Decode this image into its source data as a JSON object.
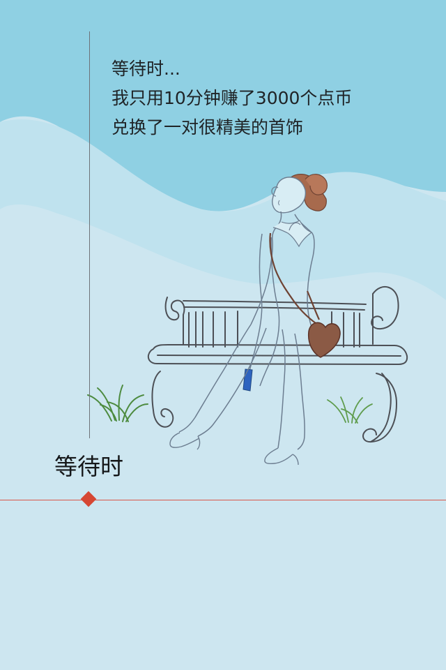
{
  "story": {
    "line1": "等待时...",
    "line2": "我只用10分钟赚了3000个点币",
    "line3": "兑换了一对很精美的首饰"
  },
  "chapter": {
    "title": "等待时"
  },
  "colors": {
    "sky": "#8fd0e3",
    "background": "#cde6f0",
    "accent_line": "#d85649",
    "accent_marker": "#d64733",
    "hair": "#a76a4d",
    "bag": "#8b5a45",
    "phone": "#2d63bf",
    "grass": "#4d8b3f"
  }
}
